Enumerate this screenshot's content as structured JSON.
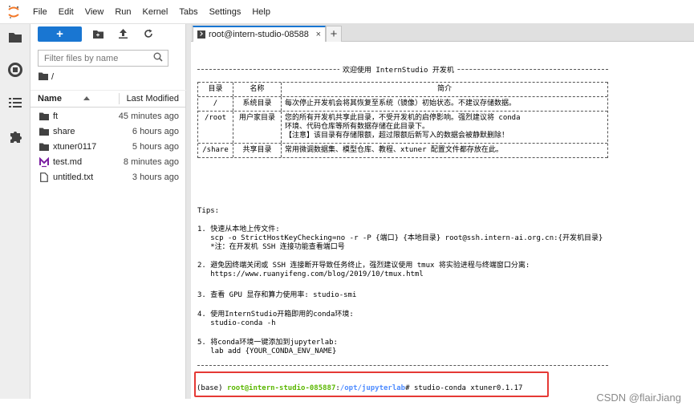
{
  "menubar": {
    "items": [
      "File",
      "Edit",
      "View",
      "Run",
      "Kernel",
      "Tabs",
      "Settings",
      "Help"
    ]
  },
  "activity": {
    "icons": [
      "folder-icon",
      "running-icon",
      "commands-icon",
      "extension-icon"
    ]
  },
  "filebrowser": {
    "new_label": "+",
    "filter_placeholder": "Filter files by name",
    "path": "/",
    "columns": {
      "name": "Name",
      "modified": "Last Modified"
    },
    "files": [
      {
        "name": "ft",
        "modified": "45 minutes ago",
        "icon": "folder-icon"
      },
      {
        "name": "share",
        "modified": "6 hours ago",
        "icon": "folder-icon"
      },
      {
        "name": "xtuner0117",
        "modified": "5 hours ago",
        "icon": "folder-icon"
      },
      {
        "name": "test.md",
        "modified": "8 minutes ago",
        "icon": "markdown-icon"
      },
      {
        "name": "untitled.txt",
        "modified": "3 hours ago",
        "icon": "text-file-icon"
      }
    ]
  },
  "tabs": {
    "active_label": "root@intern-studio-08588",
    "close": "×",
    "add": "+"
  },
  "terminal": {
    "banner": "欢迎使用 InternStudio 开发机",
    "table_headers": [
      "目录",
      "名称",
      "简介"
    ],
    "table_rows": [
      {
        "dir": "/",
        "name": "系统目录",
        "desc": "每次停止开发机会将其恢复至系统（镜像）初始状态。不建议存储数据。"
      },
      {
        "dir": "/root",
        "name": "用户家目录",
        "desc": "您的所有开发机共享此目录，不受开发机的启停影响。强烈建议将 conda\n环境、代码仓库等所有数据存储在此目录下。\n【注意】该目录有存储限额，超过限额后新写入的数据会被静默删除！"
      },
      {
        "dir": "/share",
        "name": "共享目录",
        "desc": "常用微调数据集、模型仓库、教程、xtuner 配置文件都存放在此。"
      }
    ],
    "tips_title": "Tips:",
    "tips": [
      "1. 快速从本地上传文件:\n   scp -o StrictHostKeyChecking=no -r -P {端口} {本地目录} root@ssh.intern-ai.org.cn:{开发机目录}\n   *注：在开发机 SSH 连接功能查看端口号",
      "2. 避免因终端关闭或 SSH 连接断开导致任务终止，强烈建议使用 tmux 将实验进程与终端窗口分离:\n   https://www.ruanyifeng.com/blog/2019/10/tmux.html",
      "3. 查看 GPU 显存和算力使用率: studio-smi",
      "4. 使用InternStudio开箱即用的conda环境:\n   studio-conda -h",
      "5. 将conda环境一键添加到jupyterlab:\n   lab add {YOUR_CONDA_ENV_NAME}"
    ],
    "prompt_env": "(base) ",
    "prompt_user": "root@intern-studio-085887",
    "prompt_colon": ":",
    "prompt_path": "/opt/jupyterlab",
    "prompt_symbol": "# ",
    "command": "studio-conda xtuner0.1.17"
  },
  "watermark": "CSDN @flairJiang",
  "colors": {
    "accent": "#1976d2",
    "prompt_user": "#5ab700",
    "prompt_path": "#4f8cff",
    "highlight_box": "#e53935"
  }
}
